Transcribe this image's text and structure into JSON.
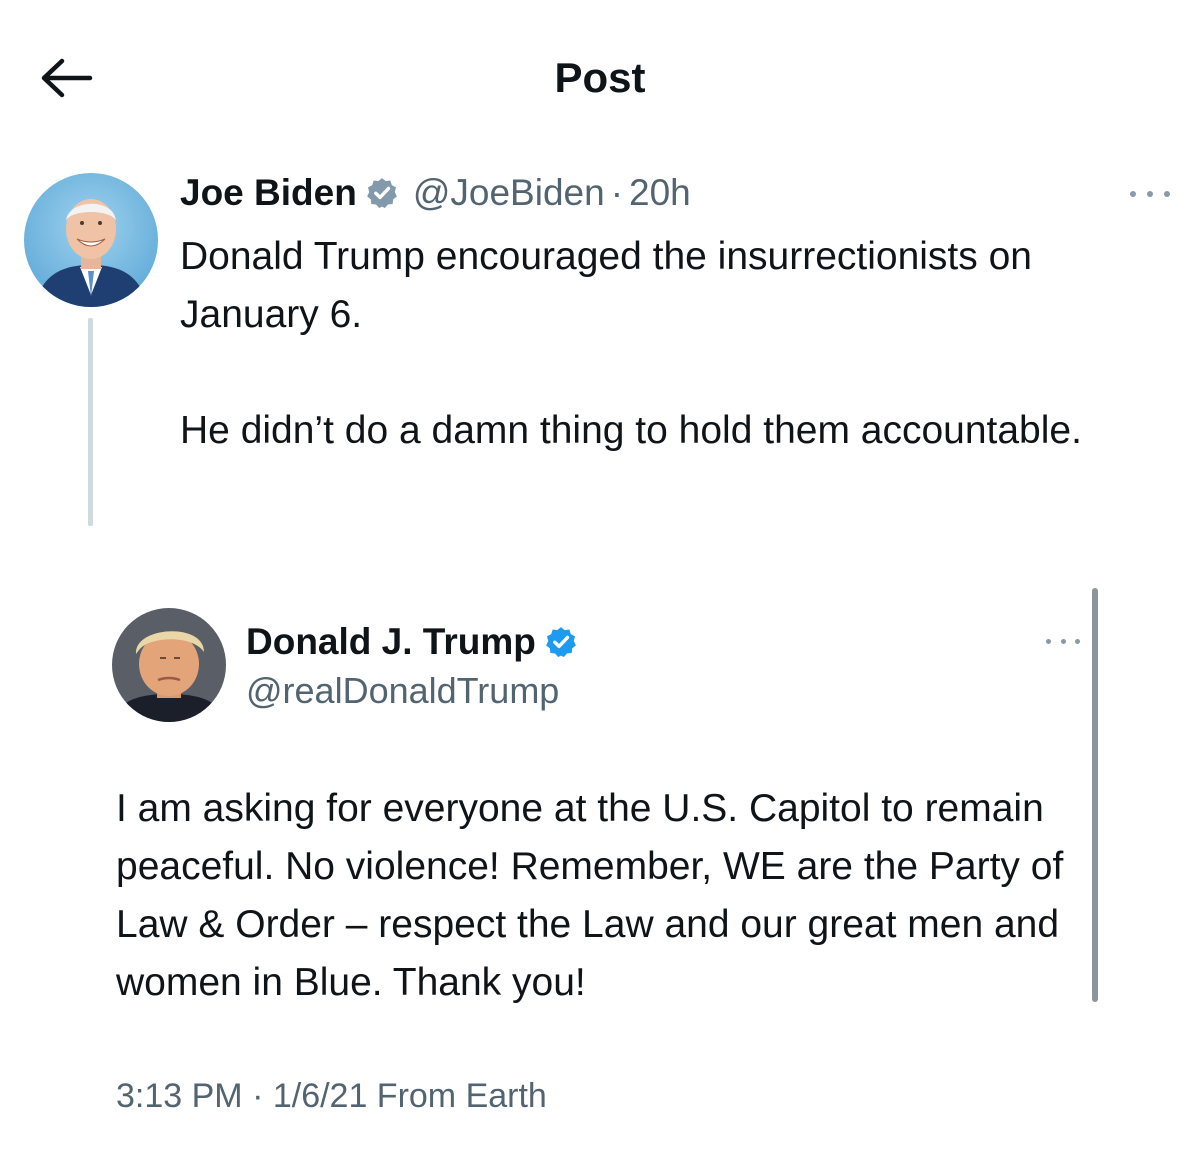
{
  "header": {
    "title": "Post",
    "back_icon": "arrow-left-icon"
  },
  "main_post": {
    "author_name": "Joe Biden",
    "verified_icon": "verified-gray-badge-icon",
    "handle": "@JoeBiden",
    "separator": "·",
    "time": "20h",
    "more_icon": "more-dots-icon",
    "text_lines": [
      "Donald Trump encouraged the insurrectionists on January 6.",
      "He didn’t do a damn thing to hold them accountable."
    ]
  },
  "quoted_post": {
    "author_name": "Donald J. Trump",
    "verified_icon": "verified-blue-badge-icon",
    "handle": "@realDonaldTrump",
    "more_icon": "more-dots-icon",
    "text": "I am asking for everyone at the U.S. Capitol to remain peaceful. No violence! Remember, WE are the Party of Law & Order – respect the Law and our great men and women in Blue. Thank you!",
    "timestamp": "3:13 PM · 1/6/21 From Earth"
  },
  "colors": {
    "text_primary": "#0f1419",
    "text_secondary": "#536471",
    "verified_blue": "#1d9bf0",
    "verified_gray": "#829aab",
    "thread_line": "#cfd9de"
  }
}
